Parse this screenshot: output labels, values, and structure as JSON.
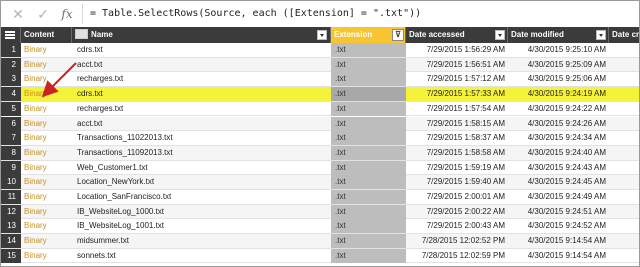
{
  "formula_bar": {
    "cancel_icon": "close-icon",
    "commit_icon": "check-icon",
    "fx_label": "fx",
    "formula": "= Table.SelectRows(Source, each ([Extension] = \".txt\"))"
  },
  "columns": {
    "content": "Content",
    "name": "Name",
    "extension": "Extension",
    "date_accessed": "Date accessed",
    "date_modified": "Date modified",
    "date_created": "Date crea"
  },
  "colors": {
    "header_bg": "#3b3b3b",
    "extension_header": "#f7c531",
    "selected_row": "#f5f23c",
    "binary_text": "#c8901e",
    "arrow": "#cc2222"
  },
  "rows": [
    {
      "num": "1",
      "content": "Binary",
      "name": "cdrs.txt",
      "ext": ".txt",
      "accessed": "7/29/2015 1:56:29 AM",
      "modified": "4/30/2015 9:25:10 AM"
    },
    {
      "num": "2",
      "content": "Binary",
      "name": "acct.txt",
      "ext": ".txt",
      "accessed": "7/29/2015 1:56:51 AM",
      "modified": "4/30/2015 9:25:09 AM"
    },
    {
      "num": "3",
      "content": "Binary",
      "name": "recharges.txt",
      "ext": ".txt",
      "accessed": "7/29/2015 1:57:12 AM",
      "modified": "4/30/2015 9:25:06 AM"
    },
    {
      "num": "4",
      "content": "Binary",
      "name": "cdrs.txt",
      "ext": ".txt",
      "accessed": "7/29/2015 1:57:33 AM",
      "modified": "4/30/2015 9:24:19 AM"
    },
    {
      "num": "5",
      "content": "Binary",
      "name": "recharges.txt",
      "ext": ".txt",
      "accessed": "7/29/2015 1:57:54 AM",
      "modified": "4/30/2015 9:24:22 AM"
    },
    {
      "num": "6",
      "content": "Binary",
      "name": "acct.txt",
      "ext": ".txt",
      "accessed": "7/29/2015 1:58:15 AM",
      "modified": "4/30/2015 9:24:26 AM"
    },
    {
      "num": "7",
      "content": "Binary",
      "name": "Transactions_11022013.txt",
      "ext": ".txt",
      "accessed": "7/29/2015 1:58:37 AM",
      "modified": "4/30/2015 9:24:34 AM"
    },
    {
      "num": "8",
      "content": "Binary",
      "name": "Transactions_11092013.txt",
      "ext": ".txt",
      "accessed": "7/29/2015 1:58:58 AM",
      "modified": "4/30/2015 9:24:40 AM"
    },
    {
      "num": "9",
      "content": "Binary",
      "name": "Web_Customer1.txt",
      "ext": ".txt",
      "accessed": "7/29/2015 1:59:19 AM",
      "modified": "4/30/2015 9:24:43 AM"
    },
    {
      "num": "10",
      "content": "Binary",
      "name": "Location_NewYork.txt",
      "ext": ".txt",
      "accessed": "7/29/2015 1:59:40 AM",
      "modified": "4/30/2015 9:24:45 AM"
    },
    {
      "num": "11",
      "content": "Binary",
      "name": "Location_SanFrancisco.txt",
      "ext": ".txt",
      "accessed": "7/29/2015 2:00:01 AM",
      "modified": "4/30/2015 9:24:49 AM"
    },
    {
      "num": "12",
      "content": "Binary",
      "name": "IB_WebsiteLog_1000.txt",
      "ext": ".txt",
      "accessed": "7/29/2015 2:00:22 AM",
      "modified": "4/30/2015 9:24:51 AM"
    },
    {
      "num": "13",
      "content": "Binary",
      "name": "IB_WebsiteLog_1001.txt",
      "ext": ".txt",
      "accessed": "7/29/2015 2:00:43 AM",
      "modified": "4/30/2015 9:24:52 AM"
    },
    {
      "num": "14",
      "content": "Binary",
      "name": "midsummer.txt",
      "ext": ".txt",
      "accessed": "7/28/2015 12:02:52 PM",
      "modified": "4/30/2015 9:14:54 AM"
    },
    {
      "num": "15",
      "content": "Binary",
      "name": "sonnets.txt",
      "ext": ".txt",
      "accessed": "7/28/2015 12:02:59 PM",
      "modified": "4/30/2015 9:14:54 AM"
    }
  ],
  "selected_row_index": 3
}
